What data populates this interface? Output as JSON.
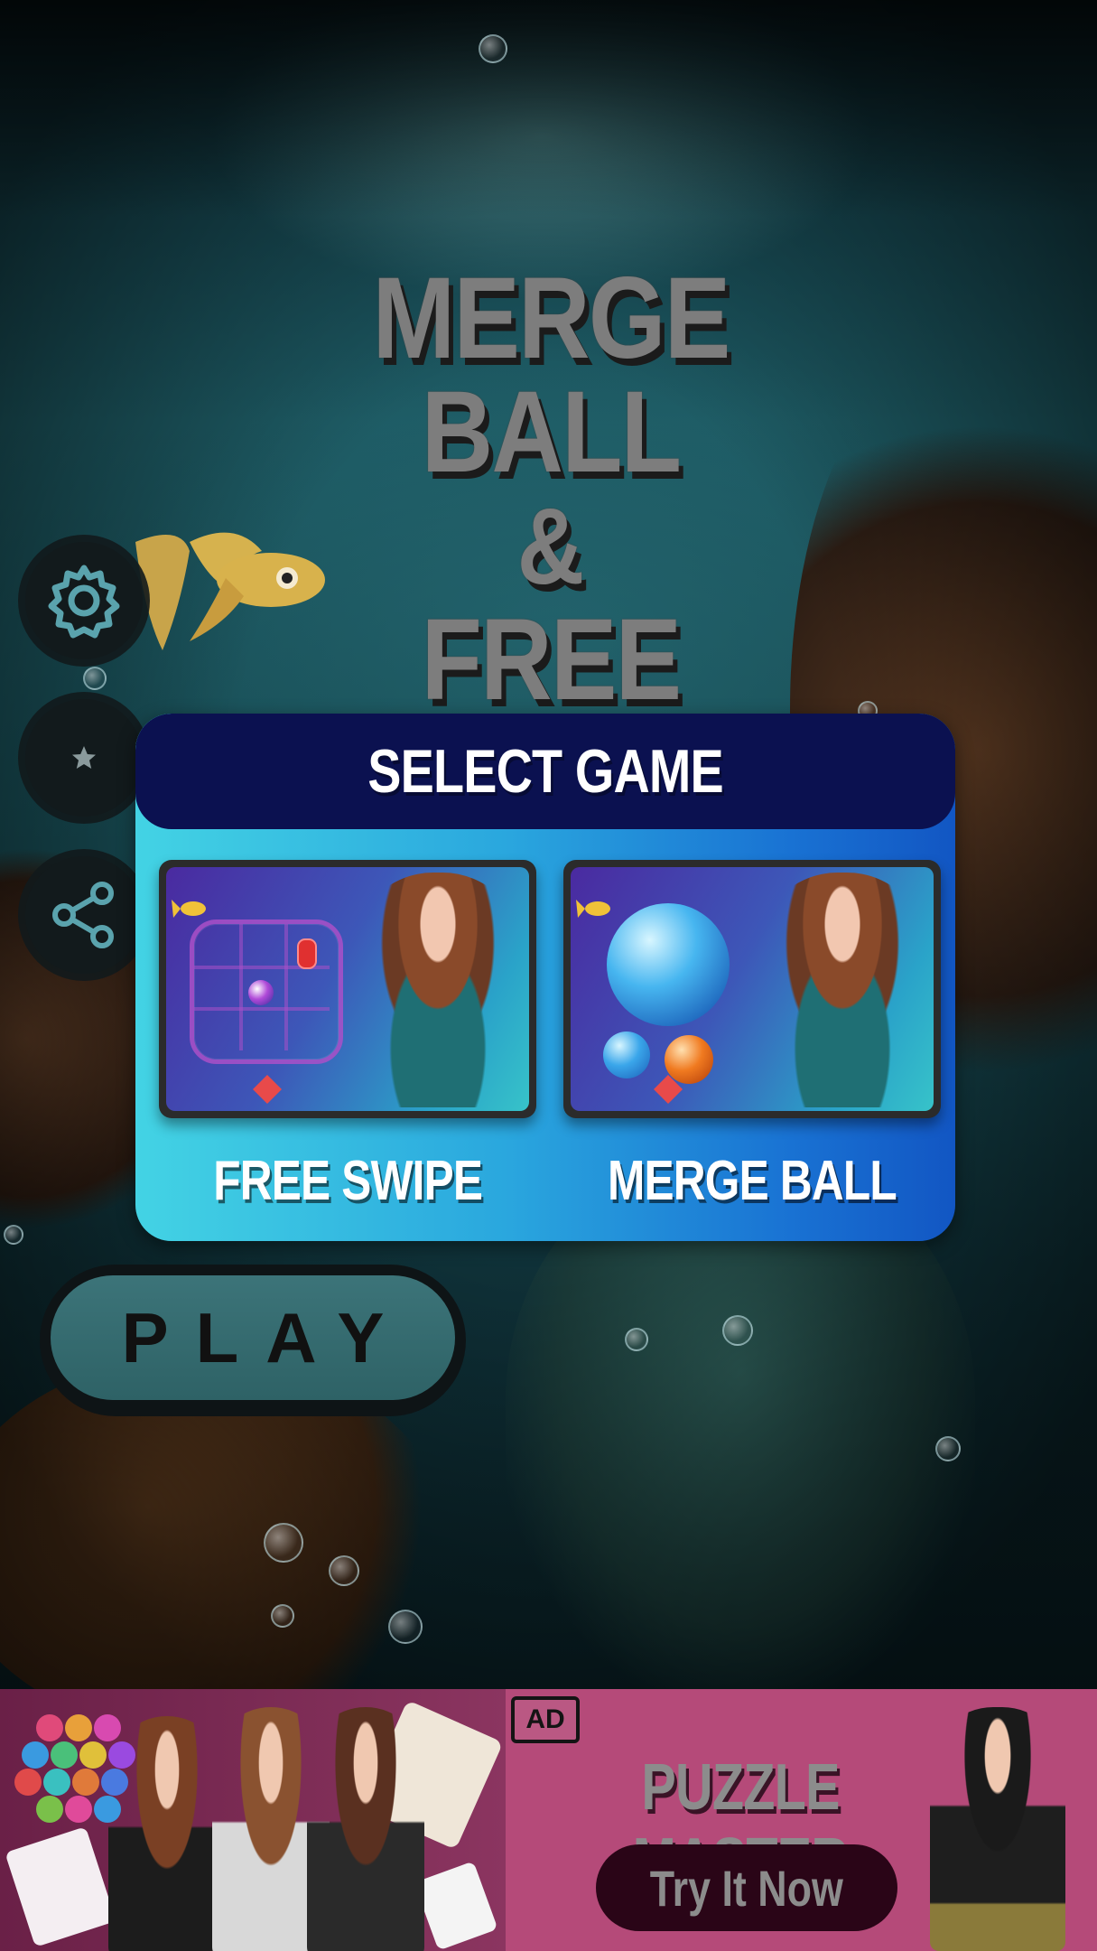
{
  "title": {
    "line1": "MERGE BALL",
    "line2": "&",
    "line3": "FREE SWIPE"
  },
  "side_buttons": [
    {
      "icon": "gear-icon"
    },
    {
      "icon": "star-icon"
    },
    {
      "icon": "share-icon"
    }
  ],
  "select_game": {
    "header": "SELECT GAME",
    "games": [
      {
        "label": "FREE SWIPE"
      },
      {
        "label": "MERGE BALL"
      }
    ]
  },
  "play_button": {
    "label": "PLAY"
  },
  "ad": {
    "badge": "AD",
    "title": "PUZZLE MASTER",
    "cta": "Try It Now"
  },
  "colors": {
    "panel_header": "#0b1150",
    "panel_gradient_start": "#43d3e4",
    "panel_gradient_end": "#1256c3",
    "play_button": "#3c7479",
    "ad_background": "#b54a79",
    "ad_cta": "#2a0517"
  }
}
